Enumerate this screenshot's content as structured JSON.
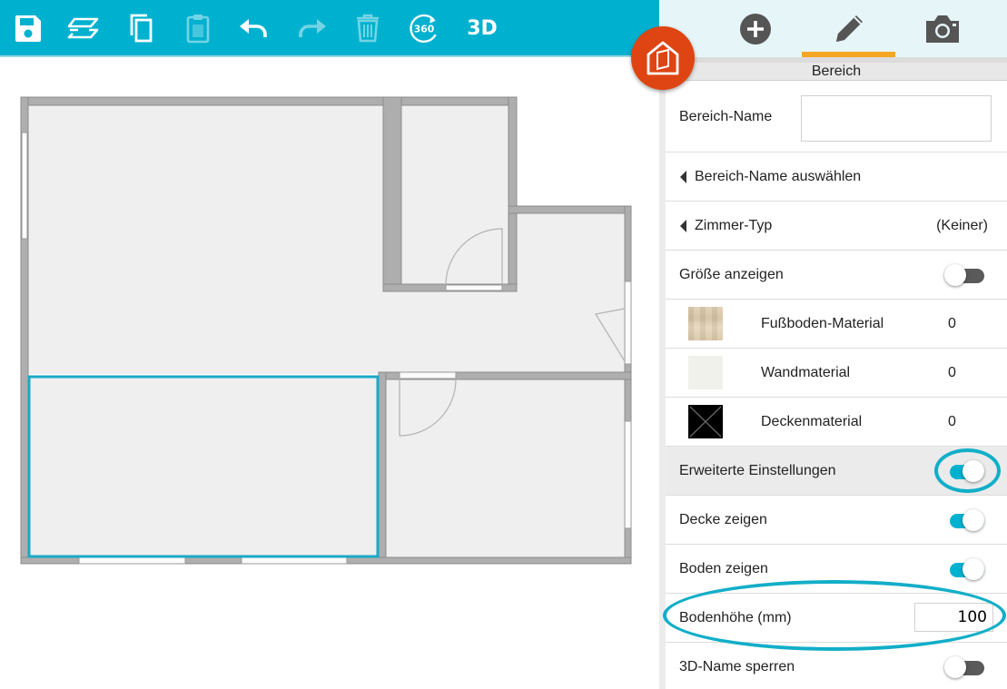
{
  "toolbar": {
    "items": [
      {
        "name": "save-icon",
        "enabled": true
      },
      {
        "name": "layers-icon",
        "enabled": true
      },
      {
        "name": "copy-icon",
        "enabled": true
      },
      {
        "name": "paste-icon",
        "enabled": false
      },
      {
        "name": "undo-icon",
        "enabled": true
      },
      {
        "name": "redo-icon",
        "enabled": false
      },
      {
        "name": "trash-icon",
        "enabled": false
      },
      {
        "name": "view-360-icon",
        "enabled": true
      }
    ],
    "view360_label": "360",
    "view3d_label": "3D"
  },
  "panel": {
    "tabs": [
      {
        "name": "add-icon",
        "active": false
      },
      {
        "name": "pencil-icon",
        "active": true
      },
      {
        "name": "camera-icon",
        "active": false
      }
    ],
    "header": "Bereich",
    "area_name_label": "Bereich-Name",
    "area_name_value": "",
    "select_area_name_label": "Bereich-Name auswählen",
    "room_type_label": "Zimmer-Typ",
    "room_type_value": "(Keiner)",
    "show_size_label": "Größe anzeigen",
    "show_size_on": false,
    "materials": [
      {
        "label": "Fußboden-Material",
        "value": "0",
        "swatch": "wood"
      },
      {
        "label": "Wandmaterial",
        "value": "0",
        "swatch": "#f1f1eb"
      },
      {
        "label": "Deckenmaterial",
        "value": "0",
        "swatch": "#000000"
      }
    ],
    "advanced_label": "Erweiterte Einstellungen",
    "advanced_on": true,
    "show_ceiling_label": "Decke zeigen",
    "show_ceiling_on": true,
    "show_floor_label": "Boden zeigen",
    "show_floor_on": true,
    "floor_height_label": "Bodenhöhe (mm)",
    "floor_height_value": "100",
    "lock_3d_name_label": "3D-Name sperren",
    "lock_3d_name_on": false
  },
  "colors": {
    "toolbar": "#00b1cf",
    "accent": "#00b1cf",
    "active_tab_underline": "#f5a623",
    "fab": "#de4512",
    "selection": "#19a9c6",
    "annotation": "#12aec8"
  }
}
